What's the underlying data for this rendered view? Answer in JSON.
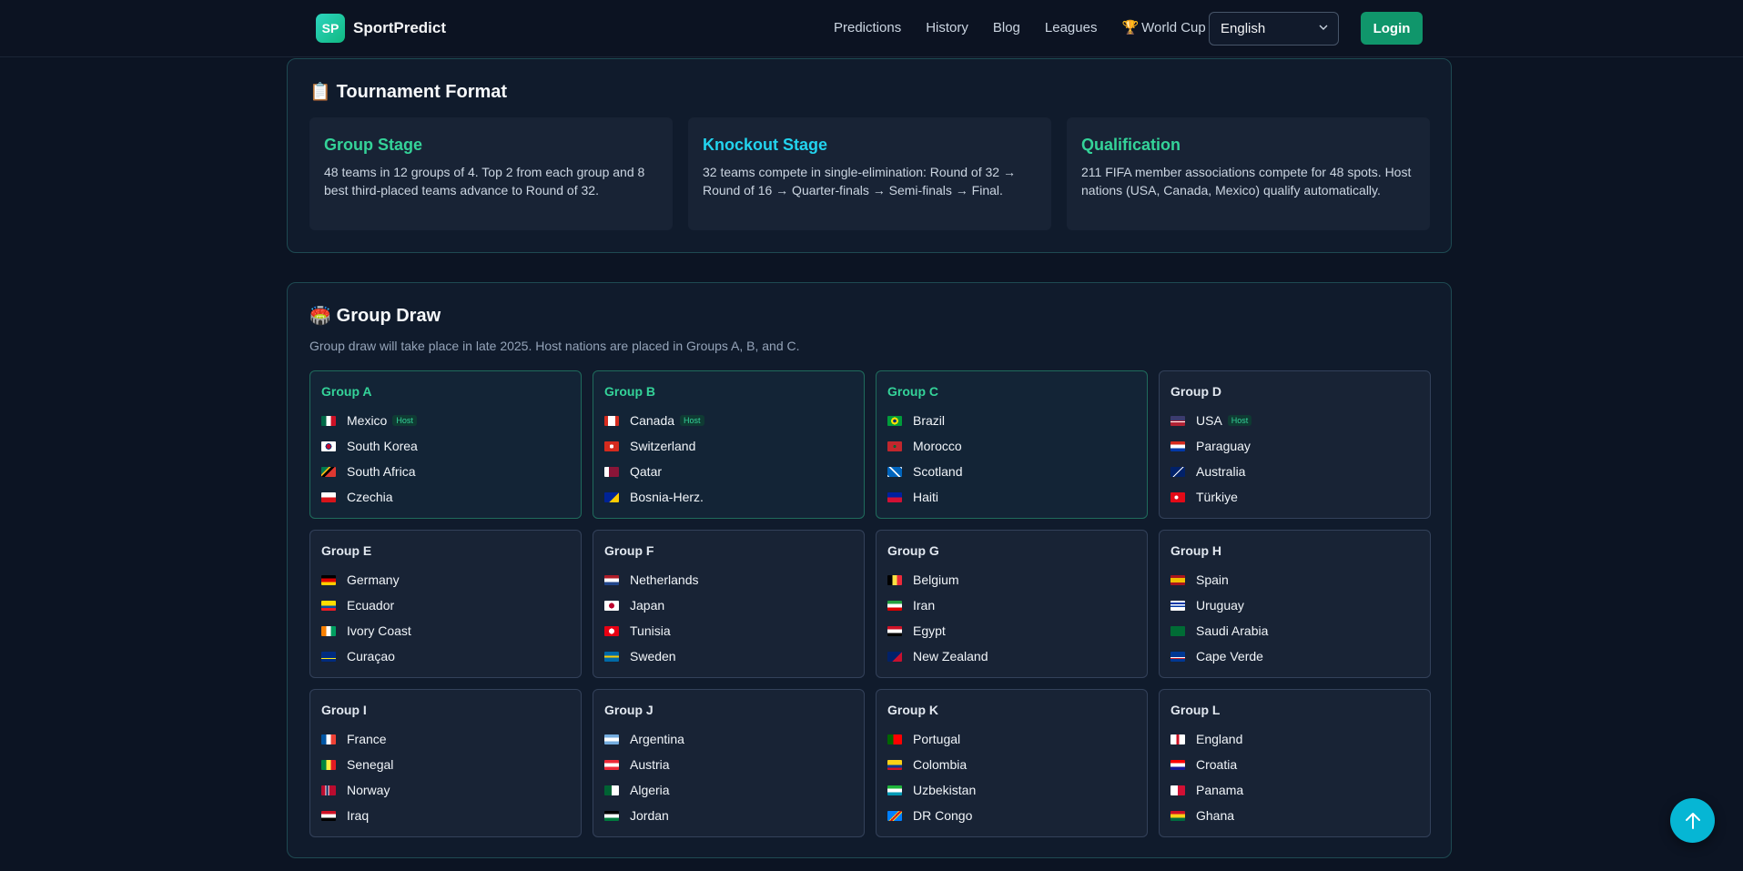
{
  "header": {
    "logo_badge": "SP",
    "logo_text": "SportPredict",
    "nav": [
      "Predictions",
      "History",
      "Blog",
      "Leagues"
    ],
    "worldcup_label": "World Cup",
    "language": "English",
    "login_label": "Login"
  },
  "format": {
    "title": "Tournament Format",
    "cards": [
      {
        "title": "Group Stage",
        "text": "48 teams in 12 groups of 4. Top 2 from each group and 8 best third-placed teams advance to Round of 32."
      },
      {
        "title": "Knockout Stage",
        "text": "32 teams compete in single-elimination: Round of 32 → Round of 16 → Quarter-finals → Semi-finals → Final."
      },
      {
        "title": "Qualification",
        "text": "211 FIFA member associations compete for 48 spots. Host nations (USA, Canada, Mexico) qualify automatically."
      }
    ]
  },
  "draw": {
    "title": "Group Draw",
    "subtitle": "Group draw will take place in late 2025. Host nations are placed in Groups A, B, and C.",
    "host_label": "Host",
    "groups": [
      {
        "name": "Group A",
        "teams": [
          "Mexico",
          "South Korea",
          "South Africa",
          "Czechia"
        ]
      },
      {
        "name": "Group B",
        "teams": [
          "Canada",
          "Switzerland",
          "Qatar",
          "Bosnia-Herz."
        ]
      },
      {
        "name": "Group C",
        "teams": [
          "Brazil",
          "Morocco",
          "Scotland",
          "Haiti"
        ]
      },
      {
        "name": "Group D",
        "teams": [
          "USA",
          "Paraguay",
          "Australia",
          "Türkiye"
        ]
      },
      {
        "name": "Group E",
        "teams": [
          "Germany",
          "Ecuador",
          "Ivory Coast",
          "Curaçao"
        ]
      },
      {
        "name": "Group F",
        "teams": [
          "Netherlands",
          "Japan",
          "Tunisia",
          "Sweden"
        ]
      },
      {
        "name": "Group G",
        "teams": [
          "Belgium",
          "Iran",
          "Egypt",
          "New Zealand"
        ]
      },
      {
        "name": "Group H",
        "teams": [
          "Spain",
          "Uruguay",
          "Saudi Arabia",
          "Cape Verde"
        ]
      },
      {
        "name": "Group I",
        "teams": [
          "France",
          "Senegal",
          "Norway",
          "Iraq"
        ]
      },
      {
        "name": "Group J",
        "teams": [
          "Argentina",
          "Austria",
          "Algeria",
          "Jordan"
        ]
      },
      {
        "name": "Group K",
        "teams": [
          "Portugal",
          "Colombia",
          "Uzbekistan",
          "DR Congo"
        ]
      },
      {
        "name": "Group L",
        "teams": [
          "England",
          "Croatia",
          "Panama",
          "Ghana"
        ]
      }
    ]
  }
}
